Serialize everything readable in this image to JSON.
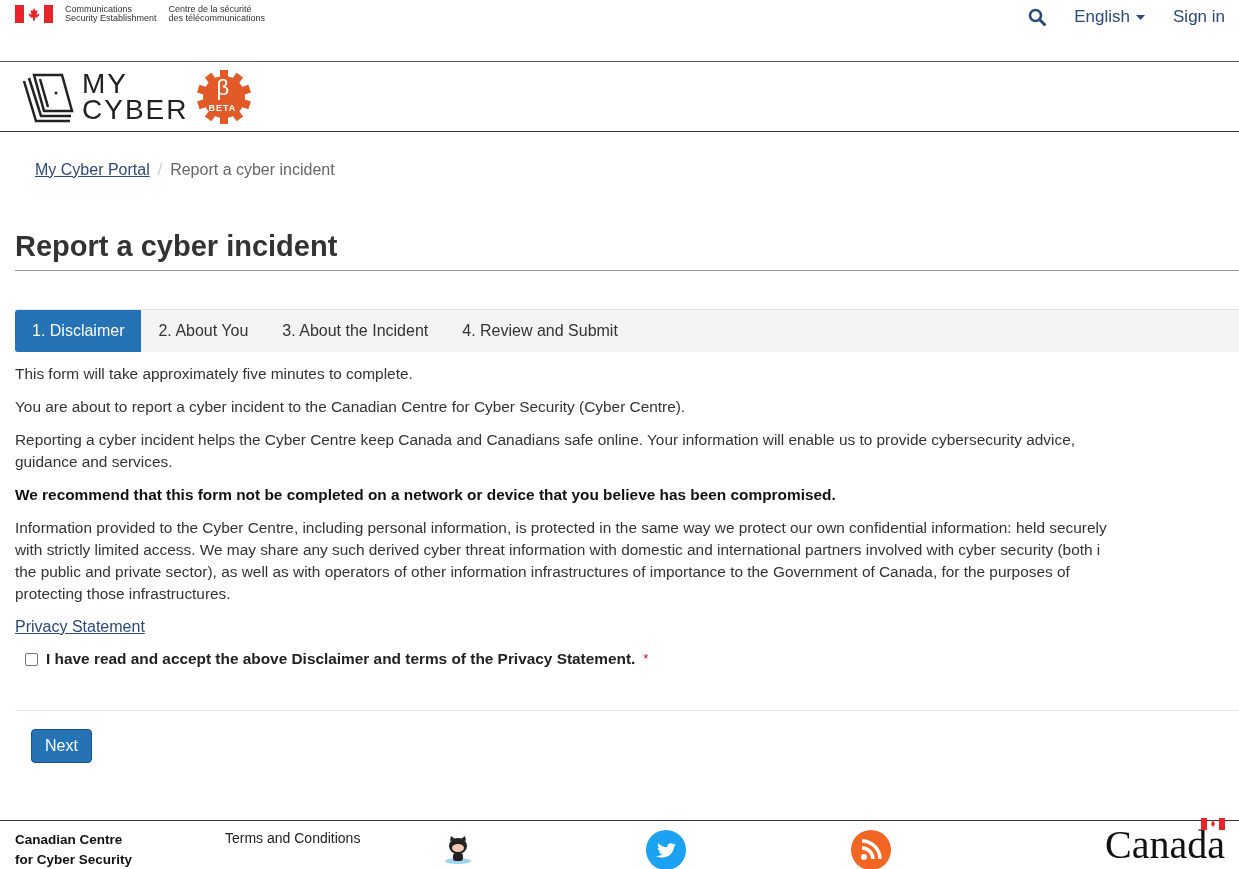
{
  "agency": {
    "english": [
      "Communications",
      "Security Establishment"
    ],
    "french": [
      "Centre de la sécurité",
      "des télécommunications"
    ]
  },
  "top_nav": {
    "language": "English",
    "sign_in": "Sign in"
  },
  "logo": {
    "line1": "MY",
    "line2": "CYBER",
    "badge_symbol": "β",
    "badge_text": "BETA"
  },
  "breadcrumb": [
    {
      "label": "My Cyber Portal",
      "link": true
    },
    {
      "separator": "/",
      "label": "Report a cyber incident",
      "link": false
    }
  ],
  "title": "Report a cyber incident",
  "tabs": [
    {
      "label": "1. Disclaimer",
      "selected": true
    },
    {
      "label": "2. About You",
      "selected": false
    },
    {
      "label": "3. About the Incident",
      "selected": false
    },
    {
      "label": "4. Review and Submit",
      "selected": false
    }
  ],
  "paragraphs": [
    {
      "kind": "text",
      "lines": [
        "This form will take approximately five minutes to complete."
      ]
    },
    {
      "kind": "text",
      "lines": [
        "You are about to report a cyber incident to the Canadian Centre for Cyber Security (Cyber Centre)."
      ]
    },
    {
      "kind": "text",
      "lines": [
        "Reporting a cyber incident helps the Cyber Centre keep Canada and Canadians safe online. Your information will enable us to provide cybersecurity advice,",
        "guidance and services."
      ]
    },
    {
      "kind": "bold",
      "lines": [
        "We recommend that this form not be completed on a network or device that you believe has been compromised."
      ]
    },
    {
      "kind": "text",
      "lines": [
        "Information provided to the Cyber Centre, including personal information, is protected in the same way we protect our own confidential information: held securely",
        "with strictly limited access. We may share any such derived cyber threat information with domestic and international partners involved with cyber security (both i",
        "the public and private sector), as well as with operators of other information infrastructures of importance to the Government of Canada, for the purposes of",
        "protecting those infrastructures."
      ]
    }
  ],
  "privacy_link": "Privacy Statement",
  "consent": {
    "label": "I have read and accept the above Disclaimer and terms of the Privacy Statement.",
    "required_mark": "*",
    "checked": false
  },
  "next_button": "Next",
  "footer": {
    "org": [
      "Canadian Centre",
      "for Cyber Security"
    ],
    "terms": "Terms and Conditions",
    "wordmark": "Canada"
  }
}
